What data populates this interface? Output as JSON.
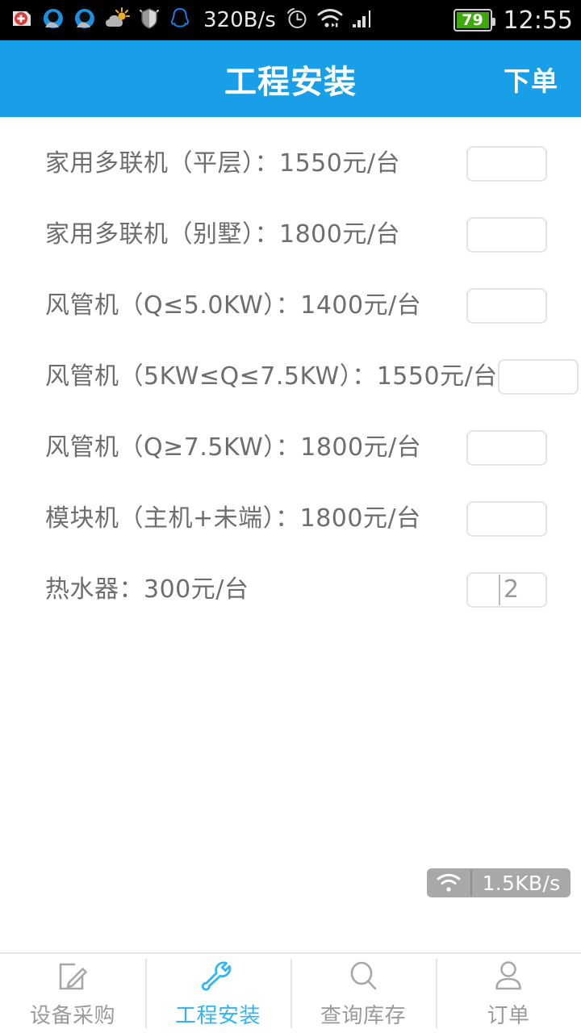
{
  "status_bar": {
    "icons": [
      "medical-cross-icon",
      "qq-browser-icon",
      "qq-browser-icon",
      "weather-sun-cloud-icon",
      "security-shield-icon",
      "qq-penguin-icon"
    ],
    "network_speed": "320B/s",
    "alarm_icon": "alarm-clock-icon",
    "wifi_icon": "wifi-icon",
    "signal_icon": "cell-signal-icon",
    "battery_level": "79",
    "time": "12:55"
  },
  "header": {
    "title": "工程安装",
    "action_label": "下单",
    "background_color": "#189fe8"
  },
  "list": {
    "items": [
      {
        "label": "家用多联机（平层）：1550元/台",
        "qty": "",
        "has_caret": false
      },
      {
        "label": "家用多联机（别墅）：1800元/台",
        "qty": "",
        "has_caret": false
      },
      {
        "label": "风管机（Q≤5.0KW）：1400元/台",
        "qty": "",
        "has_caret": false
      },
      {
        "label": "风管机（5KW≤Q≤7.5KW）：1550元/台",
        "qty": "",
        "has_caret": false
      },
      {
        "label": "风管机（Q≥7.5KW）：1800元/台",
        "qty": "",
        "has_caret": false
      },
      {
        "label": "模块机（主机+未端）：1800元/台",
        "qty": "",
        "has_caret": false
      },
      {
        "label": "热水器：300元/台",
        "qty": "2",
        "has_caret": true
      }
    ],
    "qty_placeholder": ""
  },
  "float_speed_widget": {
    "icon": "wifi-icon",
    "text": "1.5KB/s"
  },
  "tabbar": {
    "active_color": "#33b5f5",
    "inactive_color": "#9b9b9b",
    "tabs": [
      {
        "label": "设备采购",
        "icon": "edit-document-icon",
        "active": false
      },
      {
        "label": "工程安装",
        "icon": "wrench-icon",
        "active": true
      },
      {
        "label": "查询库存",
        "icon": "search-icon",
        "active": false
      },
      {
        "label": "订单",
        "icon": "person-icon",
        "active": false
      }
    ]
  }
}
